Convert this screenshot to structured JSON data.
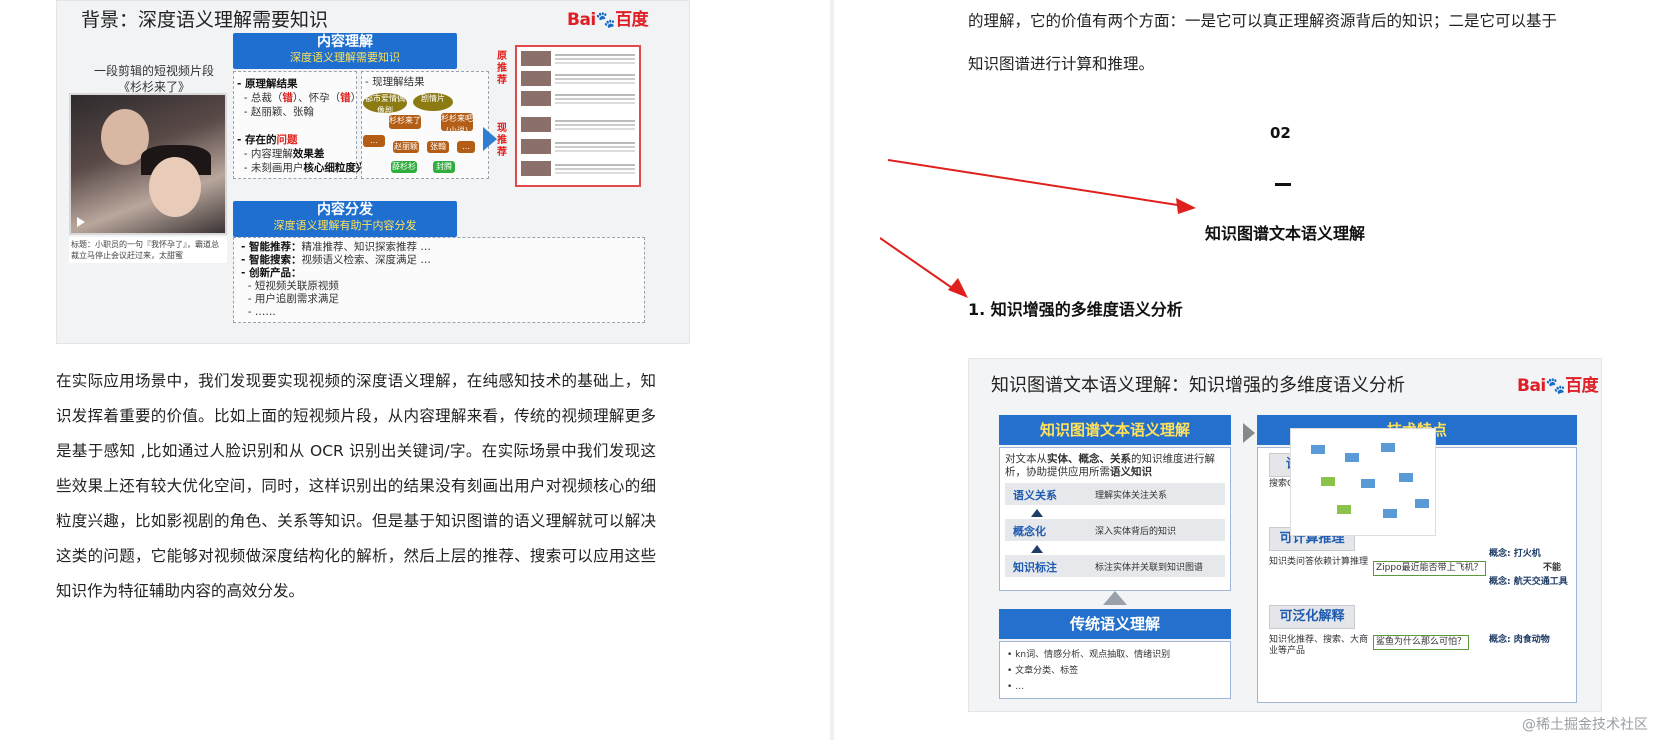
{
  "left_slide": {
    "title": "背景：深度语义理解需要知识",
    "logo_text": "Bai",
    "logo_paw": "du",
    "logo_cn": "百度",
    "clip_caption": "一段剪辑的短视频片段\n《杉杉来了》",
    "video_note": "标题：小职员的一句『我怀孕了』，霸道总裁立马停止会议赶过来，太甜蜜",
    "content_bar": {
      "title": "内容理解",
      "subtitle": "深度语义理解需要知识"
    },
    "principle": {
      "heading": "- 原理解结果",
      "line1_pre": "- 总裁（",
      "line1_red1": "错",
      "line1_mid": "）、怀孕（",
      "line1_red2": "错",
      "line1_post": "）",
      "line2": "- 赵丽颖、张翰"
    },
    "problems": {
      "heading_pre": "- 存在的",
      "heading_red": "问题",
      "line1_pre": "- 内容理解",
      "line1_bold": "效果差",
      "line2_pre": "- 未刻画用户",
      "line2_bold": "核心细粒度兴趣"
    },
    "current": {
      "heading": "- 现理解结果"
    },
    "graph_nodes": [
      "都市爱情偶像剧",
      "剧情片",
      "杉杉来了",
      "杉杉来吧(小说)",
      "…",
      "赵丽颖",
      "张翰",
      "…",
      "薛杉杉",
      "封腾"
    ],
    "rec_tags": {
      "original": "原推荐",
      "current": "现推荐"
    },
    "distribution_bar": {
      "title": "内容分发",
      "subtitle": "深度语义理解有助于内容分发"
    },
    "distribution": {
      "smart_rec_label": "- 智能推荐：",
      "smart_rec_text": "精准推荐、知识探索推荐 …",
      "smart_search_label": "- 智能搜索：",
      "smart_search_text": "视频语义检索、深度满足 …",
      "innovation_label": "- 创新产品：",
      "innovation_1": "- 短视频关联原视频",
      "innovation_2": "- 用户追剧需求满足",
      "innovation_3": "- ……"
    }
  },
  "left_paragraph": "在实际应用场景中，我们发现要实现视频的深度语义理解，在纯感知技术的基础上，知识发挥着重要的价值。比如上面的短视频片段，从内容理解来看，传统的视频理解更多是基于感知 ,比如通过人脸识别和从 OCR 识别出关键词/字。在实际场景中我们发现这些效果上还有较大优化空间，同时，这样识别出的结果没有刻画出用户对视频核心的细粒度兴趣，比如影视剧的角色、关系等知识。但是基于知识图谱的语义理解就可以解决这类的问题，它能够对视频做深度结构化的解析，然后上层的推荐、搜索可以应用这些知识作为特征辅助内容的高效分发。",
  "right_paragraph": "的理解，它的价值有两个方面：一是它可以真正理解资源背后的知识；二是它可以基于知识图谱进行计算和推理。",
  "section": {
    "number": "02",
    "title": "知识图谱文本语义理解",
    "subheading": "1. 知识增强的多维度语义分析"
  },
  "right_slide": {
    "title": "知识图谱文本语义理解：知识增强的多维度语义分析",
    "kg_header": "知识图谱文本语义理解",
    "kg_intro_1": "对文本从",
    "kg_intro_b1": "实体、概念、关系",
    "kg_intro_2": "的知识维度进行解析，协助提供应用所需",
    "kg_intro_b2": "语义知识",
    "rows": [
      {
        "key": "语义关系",
        "value": "理解实体关注关系"
      },
      {
        "key": "概念化",
        "value": "深入实体背后的知识"
      },
      {
        "key": "知识标注",
        "value": "标注实体并关联到知识图谱"
      }
    ],
    "traditional_header": "传统语义理解",
    "traditional_items": [
      "• kn词、情感分析、观点抽取、情绪识别",
      "• 文章分类、标签",
      "• …"
    ],
    "tech_header": "技术特点",
    "features": [
      {
        "name": "语义消歧",
        "desc": "搜索Query存在歧义实体"
      },
      {
        "name": "可计算推理",
        "desc": "知识类问答依赖计算推理"
      },
      {
        "name": "可泛化解释",
        "desc": "知识化推荐、搜索、大商业等产品"
      }
    ],
    "examples": [
      {
        "query": "Zippo最近能否带上飞机？",
        "concept_label": "概念:",
        "concept": "打火机",
        "extra": "不能",
        "concept2_label": "概念:",
        "concept2": "航天交通工具"
      },
      {
        "query": "鲨鱼为什么那么可怕？",
        "concept_label": "概念:",
        "concept": "肉食动物"
      }
    ]
  },
  "watermark": "@稀土掘金技术社区",
  "colors": {
    "blue": "#2470cc",
    "red": "#e0201c",
    "yellow": "#ffe15a"
  }
}
